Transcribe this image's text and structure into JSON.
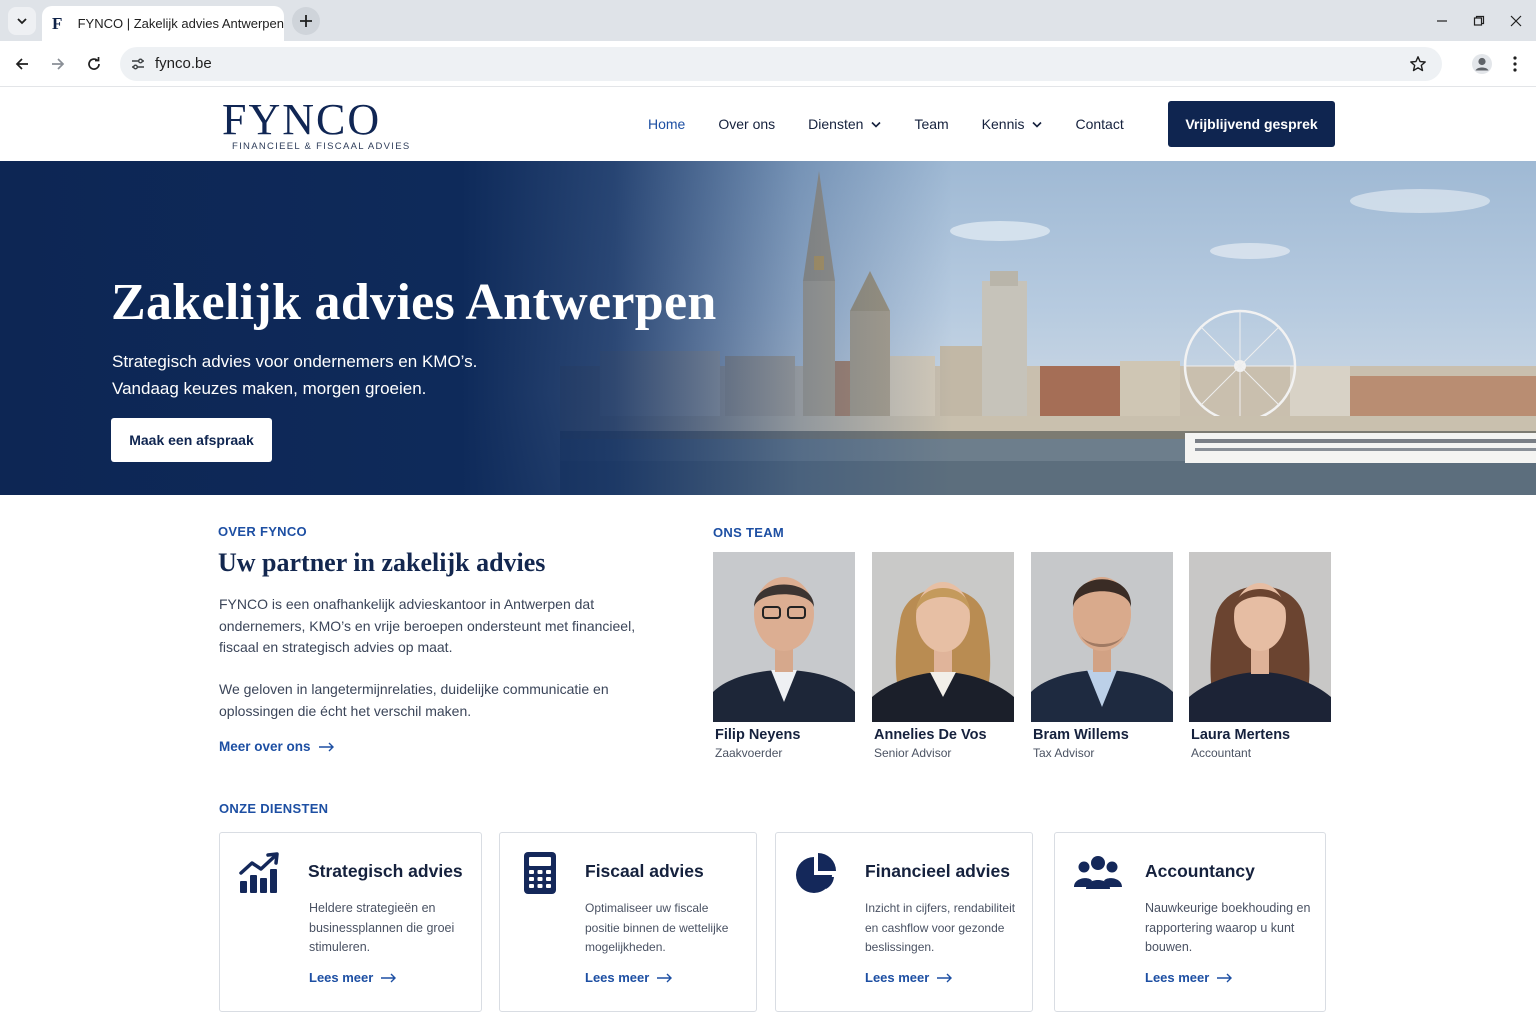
{
  "browser": {
    "tab_favicon": "F",
    "tab_title": "FYNCO | Zakelijk advies Antwerpen",
    "url": "fynco.be"
  },
  "header": {
    "logo_word": "FYNCO",
    "logo_tagline": "FINANCIEEL & FISCAAL ADVIES",
    "nav": [
      {
        "label": "Home",
        "active": true
      },
      {
        "label": "Over ons"
      },
      {
        "label": "Diensten",
        "dropdown": true
      },
      {
        "label": "Team"
      },
      {
        "label": "Kennis",
        "dropdown": true
      },
      {
        "label": "Contact"
      }
    ],
    "cta_label": "Vrijblijvend gesprek"
  },
  "hero": {
    "title": "Zakelijk advies Antwerpen",
    "subtitle_line1": "Strategisch advies voor ondernemers en KMO’s.",
    "subtitle_line2": "Vandaag keuzes maken, morgen groeien.",
    "button_label": "Maak een afspraak"
  },
  "about": {
    "eyebrow": "OVER FYNCO",
    "title": "Uw partner in zakelijk advies",
    "paragraph1": "FYNCO is een onafhankelijk advieskantoor in Antwerpen dat ondernemers, KMO’s en vrije beroepen ondersteunt met financieel, fiscaal en strategisch advies op maat.",
    "paragraph2": "We geloven in langetermijnrelaties, duidelijke communicatie en oplossingen die écht het verschil maken.",
    "link_label": "Meer over ons"
  },
  "team": {
    "eyebrow": "ONS TEAM",
    "members": [
      {
        "name": "Filip Neyens",
        "role": "Zaakvoerder"
      },
      {
        "name": "Annelies De Vos",
        "role": "Senior Advisor"
      },
      {
        "name": "Bram Willems",
        "role": "Tax Advisor"
      },
      {
        "name": "Laura Mertens",
        "role": "Accountant"
      }
    ]
  },
  "services": {
    "eyebrow": "ONZE DIENSTEN",
    "items": [
      {
        "icon": "growth-chart-icon",
        "title": "Strategisch advies",
        "text": "Heldere strategieën en businessplannen die groei stimuleren.",
        "link": "Lees meer"
      },
      {
        "icon": "calculator-icon",
        "title": "Fiscaal advies",
        "text": "Optimaliseer uw fiscale positie binnen de wettelijke mogelijkheden.",
        "link": "Lees meer"
      },
      {
        "icon": "pie-chart-icon",
        "title": "Financieel advies",
        "text": "Inzicht in cijfers, rendabiliteit en cashflow voor gezonde beslissingen.",
        "link": "Lees meer"
      },
      {
        "icon": "people-group-icon",
        "title": "Accountancy",
        "text": "Nauwkeurige boekhouding en rapportering waarop u kunt bouwen.",
        "link": "Lees meer"
      }
    ]
  },
  "colors": {
    "brand_navy": "#0f2550",
    "accent_blue": "#1d4fa3"
  }
}
